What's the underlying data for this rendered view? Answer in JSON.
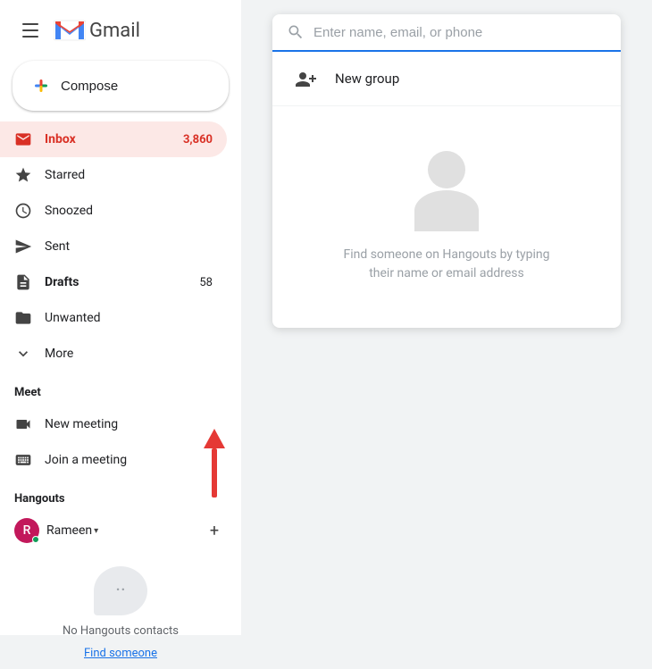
{
  "header": {
    "app_name": "Gmail",
    "hamburger_label": "Menu"
  },
  "compose": {
    "label": "Compose"
  },
  "nav": {
    "items": [
      {
        "id": "inbox",
        "label": "Inbox",
        "badge": "3,860",
        "active": true,
        "icon": "inbox"
      },
      {
        "id": "starred",
        "label": "Starred",
        "badge": "",
        "active": false,
        "icon": "star"
      },
      {
        "id": "snoozed",
        "label": "Snoozed",
        "badge": "",
        "active": false,
        "icon": "snooze"
      },
      {
        "id": "sent",
        "label": "Sent",
        "badge": "",
        "active": false,
        "icon": "send"
      },
      {
        "id": "drafts",
        "label": "Drafts",
        "badge": "58",
        "active": false,
        "bold": true,
        "icon": "drafts"
      },
      {
        "id": "unwanted",
        "label": "Unwanted",
        "badge": "",
        "active": false,
        "icon": "folder"
      },
      {
        "id": "more",
        "label": "More",
        "badge": "",
        "active": false,
        "icon": "expand"
      }
    ]
  },
  "meet": {
    "section_label": "Meet",
    "items": [
      {
        "id": "new-meeting",
        "label": "New meeting",
        "icon": "videocam"
      },
      {
        "id": "join-meeting",
        "label": "Join a meeting",
        "icon": "keyboard"
      }
    ]
  },
  "hangouts": {
    "section_label": "Hangouts",
    "user": {
      "name": "Rameen",
      "initial": "R",
      "online": true
    },
    "add_button_label": "+",
    "empty_text": "No Hangouts contacts",
    "find_link": "Find someone"
  },
  "popup": {
    "search_placeholder": "Enter name, email, or phone",
    "new_group_label": "New group",
    "empty_text": "Find someone on Hangouts by typing\ntheir name or email address"
  }
}
